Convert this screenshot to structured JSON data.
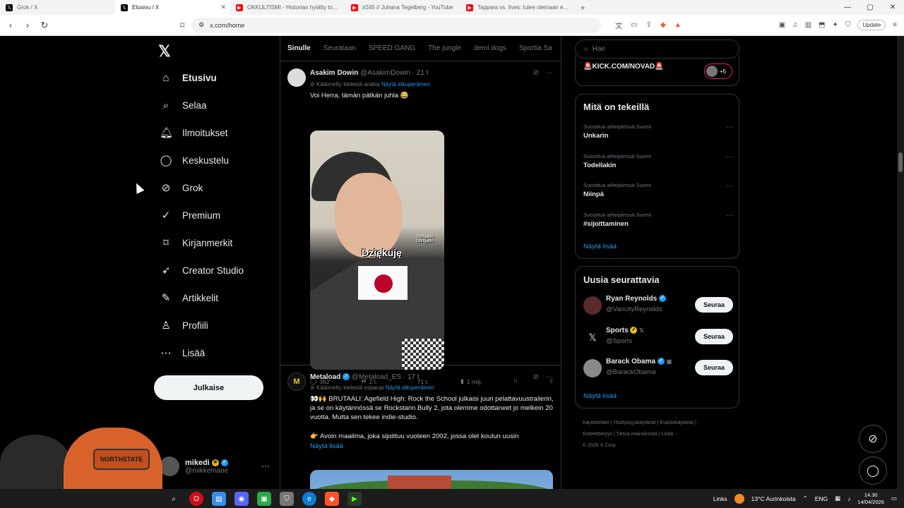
{
  "browser": {
    "tabs": [
      {
        "title": "Grok / X",
        "active": false,
        "color": "#000000",
        "icon": "x-logo-icon"
      },
      {
        "title": "Etusivu / X",
        "active": true,
        "color": "#000000",
        "icon": "x-logo-icon"
      },
      {
        "title": "OKKULTISMI - Historian hylätty totuu...",
        "active": false,
        "color": "#ff0000",
        "icon": "youtube-icon"
      },
      {
        "title": "#245 // Juhana Tegelberg - YouTube",
        "active": false,
        "color": "#ff0000",
        "icon": "youtube-icon"
      },
      {
        "title": "Tappara vs. Ilves: tulee olemaan espp...",
        "active": false,
        "color": "#ff0000",
        "icon": "youtube-icon"
      }
    ],
    "new_tab": "+",
    "url": "x.com/home",
    "update_label": "Update"
  },
  "sidebar": {
    "items": [
      {
        "label": "Etusivu",
        "icon": "home-icon",
        "glyph": "⌂",
        "active": true
      },
      {
        "label": "Selaa",
        "icon": "search-icon",
        "glyph": "⌕"
      },
      {
        "label": "Ilmoitukset",
        "icon": "bell-icon",
        "glyph": "♫"
      },
      {
        "label": "Keskustelu",
        "icon": "chat-icon",
        "glyph": "◯"
      },
      {
        "label": "Grok",
        "icon": "grok-icon",
        "glyph": "⊘"
      },
      {
        "label": "Premium",
        "icon": "premium-icon",
        "glyph": "✓"
      },
      {
        "label": "Kirjanmerkit",
        "icon": "bookmark-icon",
        "glyph": "⌑"
      },
      {
        "label": "Creator Studio",
        "icon": "rocket-icon",
        "glyph": "➶"
      },
      {
        "label": "Artikkelit",
        "icon": "article-icon",
        "glyph": "✎"
      },
      {
        "label": "Profiili",
        "icon": "person-icon",
        "glyph": "♙"
      },
      {
        "label": "Lisää",
        "icon": "more-circle-icon",
        "glyph": "⋯"
      }
    ],
    "post_button": "Julkaise",
    "account": {
      "name": "mikedi",
      "handle": "@mikkemane"
    }
  },
  "webcam": {
    "cap_text": "NORTHSTATE"
  },
  "timeline": {
    "tabs": [
      "Sinulle",
      "Seurataan",
      "SPEED GANG",
      "The jungle",
      "demi dogs",
      "Sportia Sa"
    ],
    "tweets": [
      {
        "name": "Asakim Dowin",
        "handle": "@AsakimDowin",
        "time": "· 21 t",
        "translated": "Käännetty kielestä arabia",
        "show_original": "Näytä alkuperäinen",
        "text": "Voi Herra, tämän pätkän juhla 😂",
        "media_overlay": "Dziękuję",
        "media_small": "Obrigado Obrigado",
        "replies": "362",
        "reposts": "2 t.",
        "likes": "71 t.",
        "views": "1 milj."
      },
      {
        "name": "Metaload",
        "handle": "@Metaload_ES",
        "time": "· 17 t",
        "translated": "Käännetty kielestä espanja",
        "show_original": "Näytä alkuperäinen",
        "text": "👀🙌 BRUTAALI: Agefield High: Rock the School julkaisi juuri pelattavuustrailerin, ja se on käytännössä se Rockstarin Bully 2, jota olemme odottaneet jo melkein 20 vuotta. Mutta sen tekee indie-studio.",
        "text2": "👉 Avoin maailma, joka sijoittuu vuoteen 2002, jossa olet koulun uusin",
        "show_more": "Näytä lisää"
      }
    ]
  },
  "right": {
    "search_placeholder": "Hae",
    "kick_text": "🚨KICK.COM/NOVAD🚨",
    "kick_extra": "+5",
    "trends_title": "Mitä on tekeillä",
    "trends": [
      {
        "context": "Suosittua aiheipiirissä Suomi",
        "topic": "Unkarin"
      },
      {
        "context": "Suosittua aiheipiirissä Suomi",
        "topic": "Todellakin"
      },
      {
        "context": "Suosittua aiheipiirissä Suomi",
        "topic": "Niinpä"
      },
      {
        "context": "Suosittua aiheipiirissä Suomi",
        "topic": "#sijoittaminen"
      }
    ],
    "trends_more": "Näytä lisää",
    "follow_title": "Uusia seurattavia",
    "follow": [
      {
        "name": "Ryan Reynolds",
        "handle": "@VancityReynolds",
        "button": "Seuraa",
        "badge": "blue",
        "avatar_color": "#5a2a2a"
      },
      {
        "name": "Sports",
        "handle": "@Sports",
        "button": "Seuraa",
        "badge": "gold",
        "avatar_color": "#000000"
      },
      {
        "name": "Barack Obama",
        "handle": "@BarackObama",
        "button": "Seuraa",
        "badge": "blue",
        "avatar_color": "#8a8a8a"
      }
    ],
    "follow_more": "Näytä lisää",
    "footer_line1": "Käyttöehdot  |  Yksityisyyskäytäntö  |  Evästekäytäntö  |",
    "footer_line2": "Esteettömyys  |  Tietoa mainoksista  |  Lisää ···",
    "footer_line3": "© 2026 X Corp."
  },
  "taskbar": {
    "links": "Links",
    "weather": "13°C  Aurinkoista",
    "lang": "ENG",
    "time": "14.30",
    "date": "14/04/2026"
  }
}
